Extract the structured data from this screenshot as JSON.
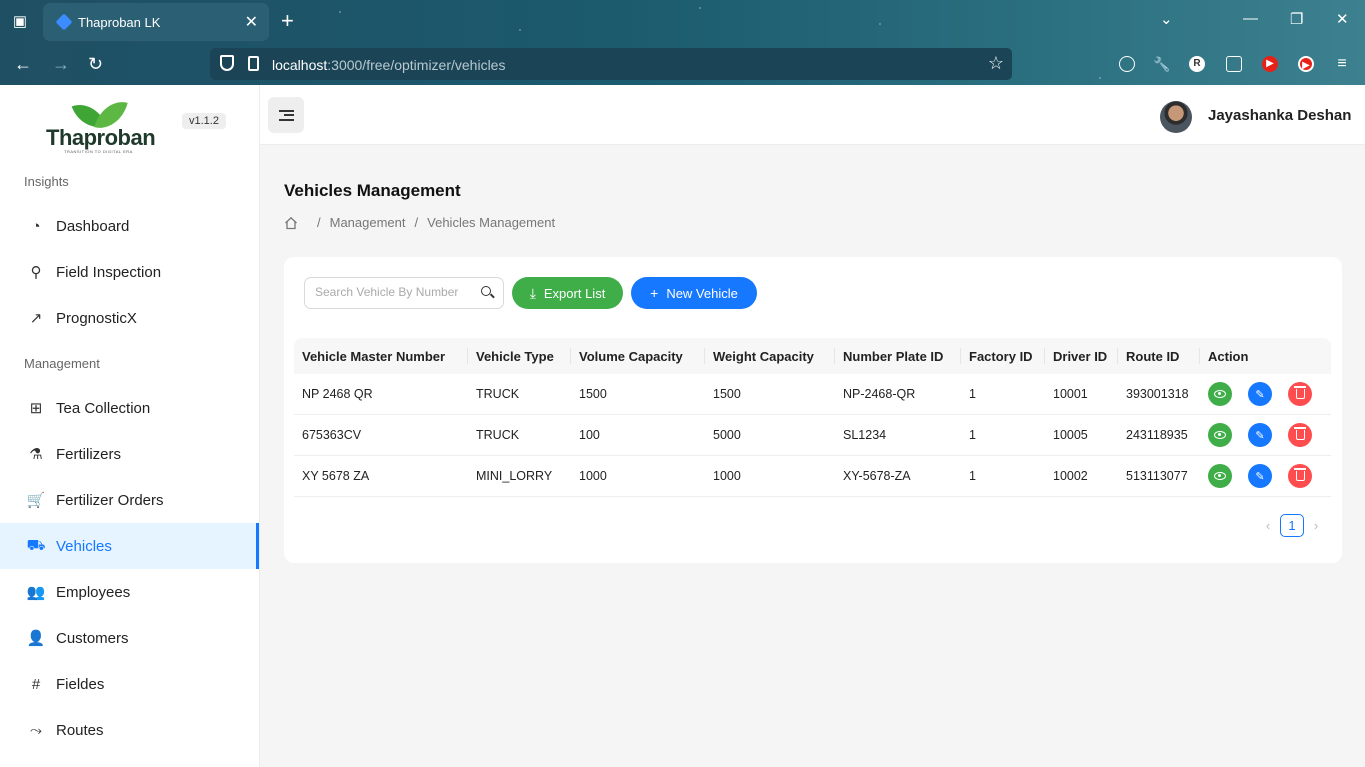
{
  "browser": {
    "tab_title": "Thaproban LK",
    "url_host": "localhost",
    "url_rest": ":3000/free/optimizer/vehicles"
  },
  "sidebar": {
    "logo_text": "Thaproban",
    "logo_tagline": "TRANSITION TO DIGITAL ERA",
    "version": "v1.1.2",
    "sections": [
      {
        "label": "Insights",
        "items": [
          {
            "label": "Dashboard",
            "icon": "dashboard-icon"
          },
          {
            "label": "Field Inspection",
            "icon": "search-icon"
          },
          {
            "label": "PrognosticX",
            "icon": "trend-icon"
          }
        ]
      },
      {
        "label": "Management",
        "items": [
          {
            "label": "Tea Collection",
            "icon": "grid-icon"
          },
          {
            "label": "Fertilizers",
            "icon": "flask-icon"
          },
          {
            "label": "Fertilizer Orders",
            "icon": "cart-icon"
          },
          {
            "label": "Vehicles",
            "icon": "car-icon",
            "active": true
          },
          {
            "label": "Employees",
            "icon": "team-icon"
          },
          {
            "label": "Customers",
            "icon": "user-icon"
          },
          {
            "label": "Fieldes",
            "icon": "hash-icon"
          },
          {
            "label": "Routes",
            "icon": "route-icon"
          }
        ]
      }
    ]
  },
  "header": {
    "username": "Jayashanka Deshan"
  },
  "page": {
    "title": "Vehicles Management",
    "breadcrumb": [
      "Management",
      "Vehicles Management"
    ]
  },
  "toolbar": {
    "search_placeholder": "Search Vehicle By Number",
    "export_label": "Export List",
    "new_label": "New Vehicle"
  },
  "table": {
    "columns": [
      "Vehicle Master Number",
      "Vehicle Type",
      "Volume Capacity",
      "Weight Capacity",
      "Number Plate ID",
      "Factory ID",
      "Driver ID",
      "Route ID",
      "Action"
    ],
    "rows": [
      [
        "NP 2468 QR",
        "TRUCK",
        "1500",
        "1500",
        "NP-2468-QR",
        "1",
        "10001",
        "393001318"
      ],
      [
        "675363CV",
        "TRUCK",
        "100",
        "5000",
        "SL1234",
        "1",
        "10005",
        "243118935"
      ],
      [
        "XY 5678 ZA",
        "MINI_LORRY",
        "1000",
        "1000",
        "XY-5678-ZA",
        "1",
        "10002",
        "513113077"
      ]
    ]
  },
  "pagination": {
    "current": "1"
  },
  "colors": {
    "primary": "#1677ff",
    "success": "#3fae49",
    "danger": "#ff4d4f"
  }
}
